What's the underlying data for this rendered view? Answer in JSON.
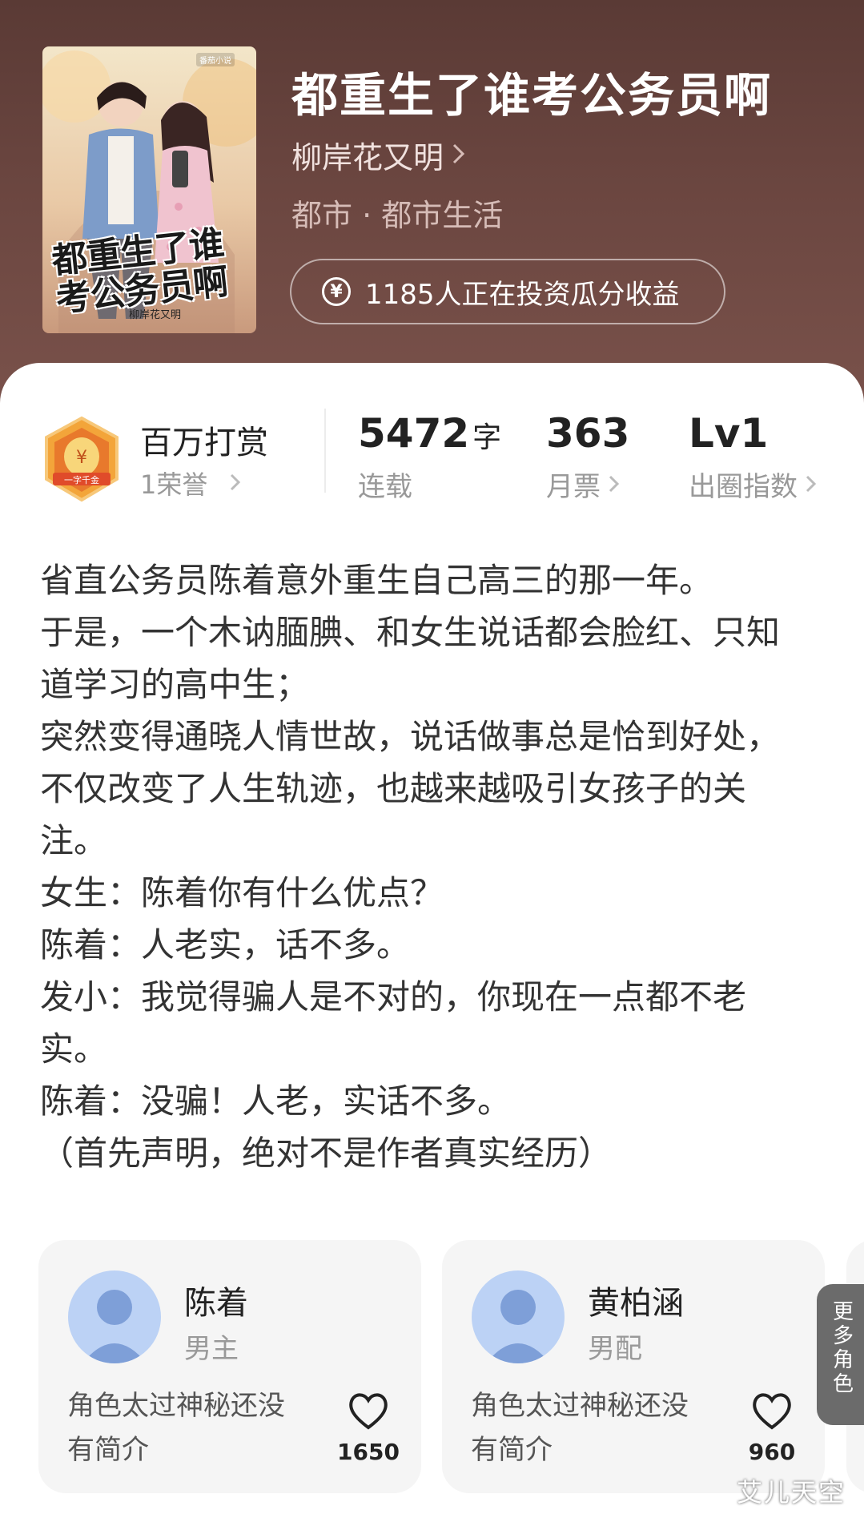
{
  "book": {
    "title": "都重生了谁考公务员啊",
    "author": "柳岸花又明",
    "genre": "都市 · 都市生活",
    "invest_text": "1185人正在投资瓜分收益",
    "cover": {
      "title": "都重生了谁考公务员啊",
      "author": "柳岸花又明",
      "badge": "番茄小说"
    }
  },
  "stats": {
    "reward": {
      "title": "百万打赏",
      "sub": "1荣誉",
      "medal_text": "一字千金"
    },
    "words": {
      "value": "5472",
      "unit": "字",
      "label": "连载"
    },
    "monthly_votes": {
      "value": "363",
      "label": "月票"
    },
    "index": {
      "value": "Lv1",
      "label": "出圈指数"
    }
  },
  "synopsis": [
    "省直公务员陈着意外重生自己高三的那一年。",
    "于是，一个木讷腼腆、和女生说话都会脸红、只知道学习的高中生；",
    "突然变得通晓人情世故，说话做事总是恰到好处，不仅改变了人生轨迹，也越来越吸引女孩子的关注。",
    "女生：陈着你有什么优点？",
    "陈着：人老实，话不多。",
    "发小：我觉得骗人是不对的，你现在一点都不老实。",
    "陈着：没骗！人老，实话不多。",
    "（首先声明，绝对不是作者真实经历）"
  ],
  "roles": [
    {
      "name": "陈着",
      "type": "男主",
      "desc": "角色太过神秘还没有简介",
      "likes": "1650"
    },
    {
      "name": "黄柏涵",
      "type": "男配",
      "desc": "角色太过神秘还没有简介",
      "likes": "960"
    }
  ],
  "more_roles_label": "更多角色",
  "watermark": "艾儿天空",
  "colors": {
    "header_bg": "#6b4640",
    "card_bg": "#ffffff",
    "role_card_bg": "#f5f5f5",
    "muted_text": "#999999",
    "more_roles_bg": "#6b6b6b"
  }
}
